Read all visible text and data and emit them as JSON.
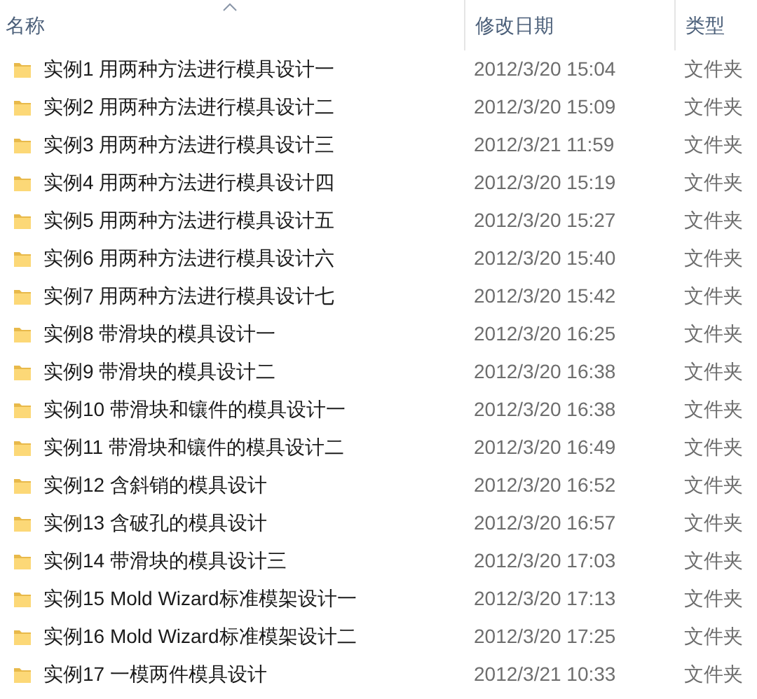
{
  "columns": [
    {
      "label": "名称",
      "sorted": true
    },
    {
      "label": "修改日期",
      "sorted": false
    },
    {
      "label": "类型",
      "sorted": false
    }
  ],
  "rows": [
    {
      "name": "实例1 用两种方法进行模具设计一",
      "date": "2012/3/20 15:04",
      "type": "文件夹"
    },
    {
      "name": "实例2 用两种方法进行模具设计二",
      "date": "2012/3/20 15:09",
      "type": "文件夹"
    },
    {
      "name": "实例3 用两种方法进行模具设计三",
      "date": "2012/3/21 11:59",
      "type": "文件夹"
    },
    {
      "name": "实例4 用两种方法进行模具设计四",
      "date": "2012/3/20 15:19",
      "type": "文件夹"
    },
    {
      "name": "实例5 用两种方法进行模具设计五",
      "date": "2012/3/20 15:27",
      "type": "文件夹"
    },
    {
      "name": "实例6 用两种方法进行模具设计六",
      "date": "2012/3/20 15:40",
      "type": "文件夹"
    },
    {
      "name": "实例7 用两种方法进行模具设计七",
      "date": "2012/3/20 15:42",
      "type": "文件夹"
    },
    {
      "name": "实例8 带滑块的模具设计一",
      "date": "2012/3/20 16:25",
      "type": "文件夹"
    },
    {
      "name": "实例9 带滑块的模具设计二",
      "date": "2012/3/20 16:38",
      "type": "文件夹"
    },
    {
      "name": "实例10 带滑块和镶件的模具设计一",
      "date": "2012/3/20 16:38",
      "type": "文件夹"
    },
    {
      "name": "实例11 带滑块和镶件的模具设计二",
      "date": "2012/3/20 16:49",
      "type": "文件夹"
    },
    {
      "name": "实例12 含斜销的模具设计",
      "date": "2012/3/20 16:52",
      "type": "文件夹"
    },
    {
      "name": "实例13 含破孔的模具设计",
      "date": "2012/3/20 16:57",
      "type": "文件夹"
    },
    {
      "name": "实例14 带滑块的模具设计三",
      "date": "2012/3/20 17:03",
      "type": "文件夹"
    },
    {
      "name": "实例15 Mold Wizard标准模架设计一",
      "date": "2012/3/20 17:13",
      "type": "文件夹"
    },
    {
      "name": "实例16 Mold Wizard标准模架设计二",
      "date": "2012/3/20 17:25",
      "type": "文件夹"
    },
    {
      "name": "实例17 一模两件模具设计",
      "date": "2012/3/21 10:33",
      "type": "文件夹"
    }
  ]
}
